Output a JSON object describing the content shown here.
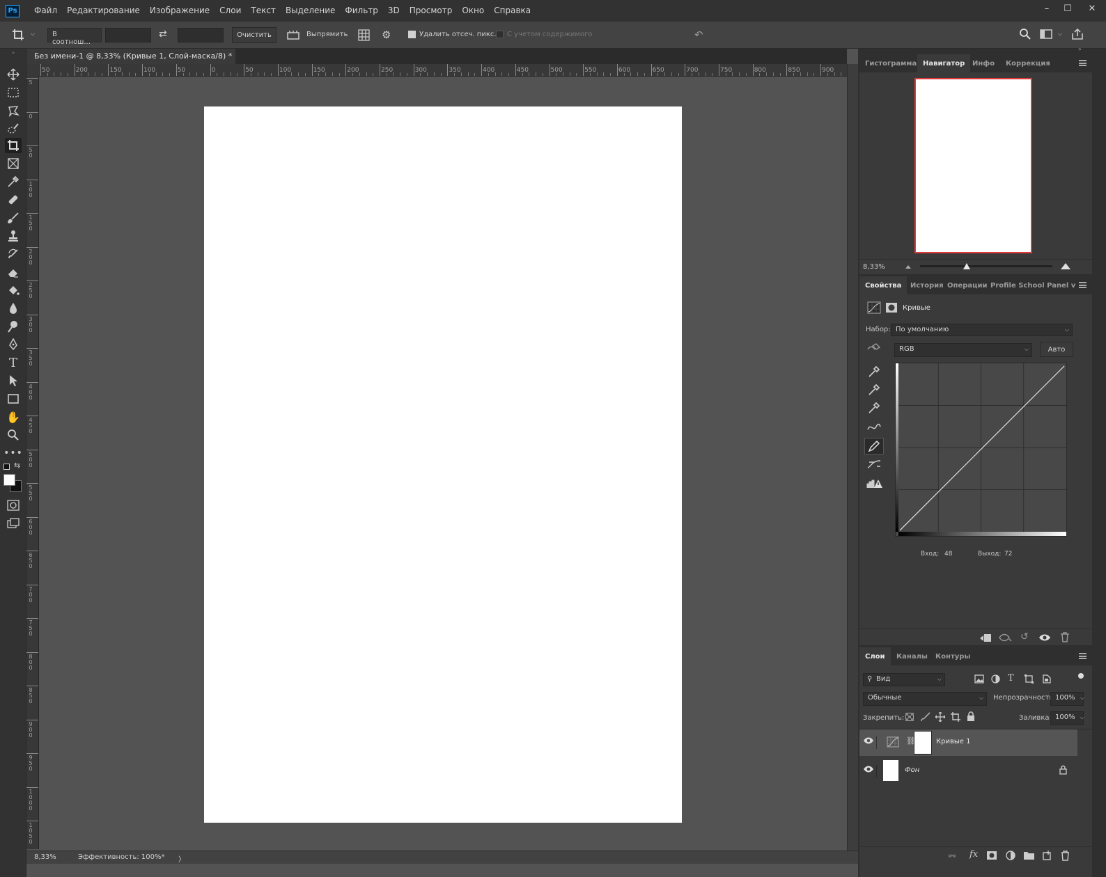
{
  "app": {
    "logo": "Ps"
  },
  "menu": [
    "Файл",
    "Редактирование",
    "Изображение",
    "Слои",
    "Текст",
    "Выделение",
    "Фильтр",
    "3D",
    "Просмотр",
    "Окно",
    "Справка"
  ],
  "window_controls": {
    "minimize": "–",
    "maximize": "☐",
    "close": "✕"
  },
  "options": {
    "ratio_select": "В соотнош...",
    "clear_button": "Очистить",
    "straighten_label": "Выпрямить",
    "delete_pixels_label": "Удалить отсеч. пикс.",
    "content_aware_label": "С учетом содержимого"
  },
  "document": {
    "tab_title": "Без имени-1 @ 8,33% (Кривые 1, Слой-маска/8) *",
    "close": "×",
    "ruler_top_labels": [
      "50",
      "200",
      "150",
      "100",
      "50",
      "0",
      "50",
      "100",
      "150",
      "200",
      "250",
      "300",
      "350",
      "400",
      "450",
      "500",
      "550",
      "600",
      "650",
      "700",
      "750",
      "800",
      "850",
      "900"
    ],
    "ruler_left_labels": [
      "5",
      "0",
      "5 0",
      "1 0 0",
      "1 5 0",
      "2 0 0",
      "2 5 0",
      "3 0 0",
      "3 5 0",
      "4 0 0",
      "4 5 0",
      "5 0 0",
      "5 5 0",
      "6 0 0",
      "6 5 0",
      "7 0 0",
      "7 5 0",
      "8 0 0",
      "8 5 0",
      "9 0 0",
      "9 5 0",
      "1 0 0 0",
      "1 0 5 0"
    ]
  },
  "status": {
    "zoom": "8,33%",
    "efficiency": "Эффективность: 100%*",
    "arrow": "〉"
  },
  "navigator": {
    "tabs": [
      "Гистограмма",
      "Навигатор",
      "Инфо",
      "Коррекция"
    ],
    "active_tab": 1,
    "zoom": "8,33%",
    "slider": 0.35
  },
  "properties": {
    "tabs": [
      "Свойства",
      "История",
      "Операции",
      "Profile School Panel v"
    ],
    "active_tab": 0,
    "title": "Кривые",
    "preset_label": "Набор:",
    "preset_value": "По умолчанию",
    "channel": "RGB",
    "auto": "Авто",
    "input_label": "Вход:",
    "input_value": "48",
    "output_label": "Выход:",
    "output_value": "72"
  },
  "layers": {
    "tabs": [
      "Слои",
      "Каналы",
      "Контуры"
    ],
    "active_tab": 0,
    "filter_label": "Вид",
    "blend_mode": "Обычные",
    "opacity_label": "Непрозрачность:",
    "opacity_value": "100%",
    "lock_label": "Закрепить:",
    "fill_label": "Заливка:",
    "fill_value": "100%",
    "items": [
      {
        "name": "Кривые 1",
        "selected": true
      },
      {
        "name": "Фон",
        "selected": false
      }
    ]
  },
  "colors": {
    "accent_red": "#e03a3a",
    "menu_bg": "#323232",
    "panel_bg": "#3a3a3a"
  }
}
